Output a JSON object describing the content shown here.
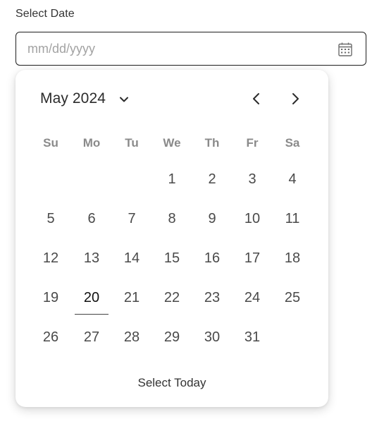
{
  "field": {
    "label": "Select Date",
    "placeholder": "mm/dd/yyyy",
    "value": ""
  },
  "calendar": {
    "month_label": "May 2024",
    "weekdays": [
      "Su",
      "Mo",
      "Tu",
      "We",
      "Th",
      "Fr",
      "Sa"
    ],
    "weeks": [
      [
        "",
        "",
        "",
        "1",
        "2",
        "3",
        "4"
      ],
      [
        "5",
        "6",
        "7",
        "8",
        "9",
        "10",
        "11"
      ],
      [
        "12",
        "13",
        "14",
        "15",
        "16",
        "17",
        "18"
      ],
      [
        "19",
        "20",
        "21",
        "22",
        "23",
        "24",
        "25"
      ],
      [
        "26",
        "27",
        "28",
        "29",
        "30",
        "31",
        ""
      ]
    ],
    "today": "20",
    "select_today_label": "Select Today"
  },
  "icons": {
    "calendar": "calendar-icon",
    "month_dropdown": "chevron-down-icon",
    "prev": "chevron-left-icon",
    "next": "chevron-right-icon"
  }
}
